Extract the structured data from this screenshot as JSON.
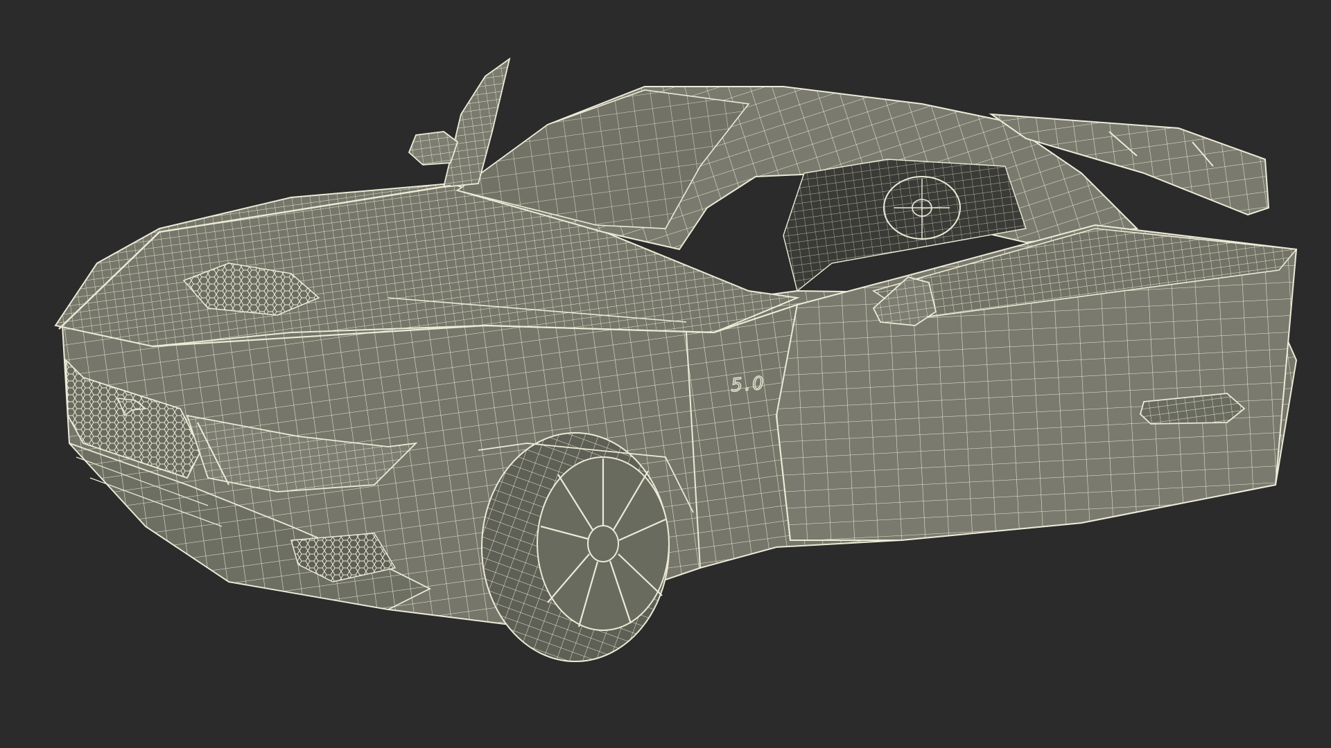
{
  "scene": {
    "background_color": "#2b2b2b",
    "surface_color": "#76776a",
    "surface_shadow_color": "#5e5f55",
    "surface_dark_color": "#3a3b36",
    "wire_color": "#ecebd8"
  },
  "car": {
    "badge_text": "5.0",
    "components": [
      "body-shell",
      "hood",
      "roof",
      "windshield",
      "front-grille",
      "headlight-left",
      "front-bumper",
      "front-wheel",
      "open-door",
      "open-door-left",
      "side-mirror-left",
      "side-mirror-right",
      "rear-spoiler",
      "interior-seat",
      "door-handle"
    ]
  }
}
